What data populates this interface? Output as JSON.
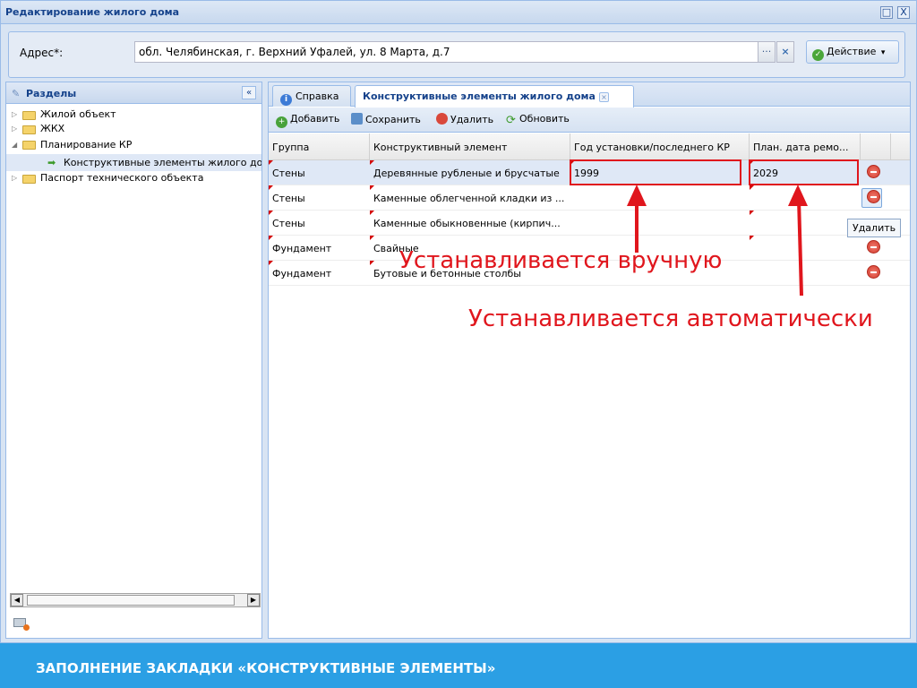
{
  "window": {
    "title": "Редактирование жилого дома",
    "restore_icon": "□",
    "close_icon": "X"
  },
  "address": {
    "label": "Адрес*:",
    "value": "обл. Челябинская, г. Верхний Уфалей, ул. 8 Марта, д.7",
    "ellipsis": "···",
    "clear": "×",
    "action_label": "Действие",
    "action_check": "✓",
    "action_arrow": "▾"
  },
  "sidebar": {
    "title": "Разделы",
    "header_icon": "✎",
    "collapse": "«",
    "items": [
      {
        "label": "Жилой объект",
        "expander": "▷"
      },
      {
        "label": "ЖКХ",
        "expander": "▷"
      },
      {
        "label": "Планирование КР",
        "expander": "◢"
      },
      {
        "label": "Конструктивные элементы жилого дома",
        "arrow": "➡"
      },
      {
        "label": "Паспорт технического объекта",
        "expander": "▷"
      }
    ],
    "scroll_left": "◀",
    "scroll_right": "▶"
  },
  "tabs": [
    {
      "label": "Справка",
      "icon": "i"
    },
    {
      "label": "Конструктивные элементы жилого дома",
      "close": "×"
    }
  ],
  "toolbar": {
    "add": "Добавить",
    "save": "Сохранить",
    "delete": "Удалить",
    "refresh": "Обновить",
    "add_icon": "+",
    "refresh_icon": "⟳"
  },
  "grid": {
    "columns": [
      "Группа",
      "Конструктивный элемент",
      "Год установки/последнего КР",
      "План. дата ремо..."
    ],
    "rows": [
      {
        "group": "Стены",
        "element": "Деревянные рубленые и брусчатые",
        "year": "1999",
        "plan": "2029"
      },
      {
        "group": "Стены",
        "element": "Каменные облегченной кладки из ...",
        "year": "",
        "plan": ""
      },
      {
        "group": "Стены",
        "element": "Каменные обыкновенные (кирпич...",
        "year": "",
        "plan": ""
      },
      {
        "group": "Фундамент",
        "element": "Свайные",
        "year": "",
        "plan": ""
      },
      {
        "group": "Фундамент",
        "element": "Бутовые и бетонные столбы",
        "year": "",
        "plan": ""
      }
    ]
  },
  "tooltip": "Удалить",
  "annotations": {
    "manual": "Устанавливается вручную",
    "auto": "Устанавливается автоматически",
    "color": "#e0161d"
  },
  "footer": {
    "title": "ЗАПОЛНЕНИЕ ЗАКЛАДКИ «КОНСТРУКТИВНЫЕ ЭЛЕМЕНТЫ»",
    "color": "#2b9fe4"
  }
}
